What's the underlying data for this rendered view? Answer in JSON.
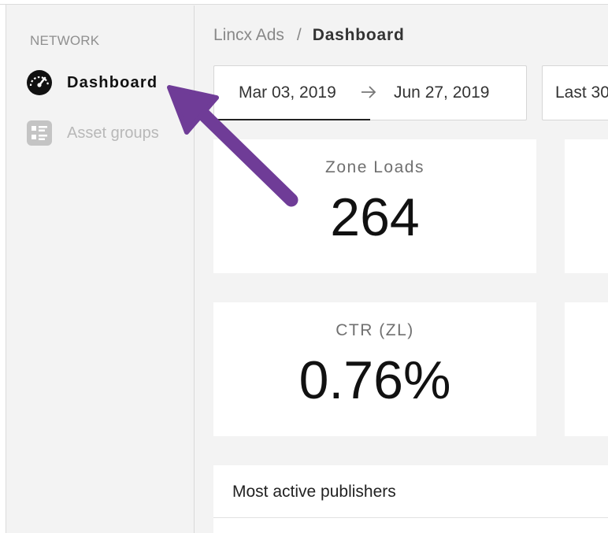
{
  "sidebar": {
    "section_label": "NETWORK",
    "items": [
      {
        "label": "Dashboard",
        "icon": "speedometer-icon",
        "active": true
      },
      {
        "label": "Asset groups",
        "icon": "asset-groups-icon",
        "active": false
      }
    ]
  },
  "breadcrumb": {
    "root": "Lincx Ads",
    "separator": "/",
    "current": "Dashboard"
  },
  "date_range": {
    "start": "Mar 03, 2019",
    "arrow_icon": "arrow-right-icon",
    "end": "Jun 27, 2019"
  },
  "preset": {
    "label": "Last 30"
  },
  "metrics": {
    "zone_loads": {
      "title": "Zone Loads",
      "value": "264"
    },
    "ctr": {
      "title": "CTR (ZL)",
      "value": "0.76%"
    }
  },
  "publishers": {
    "title": "Most active publishers"
  },
  "colors": {
    "annotation_arrow": "#6f3c97",
    "background": "#f3f3f3",
    "card": "#ffffff"
  }
}
